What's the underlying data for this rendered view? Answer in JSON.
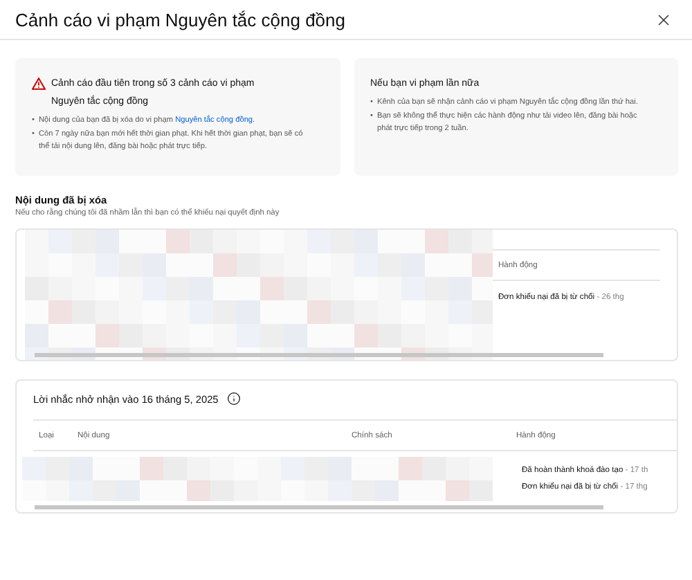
{
  "dialog": {
    "title": "Cảnh cáo vi phạm Nguyên tắc cộng đồng"
  },
  "warning_card": {
    "title": "Cảnh cáo đầu tiên trong số 3 cảnh cáo vi phạm Nguyên tắc cộng đồng",
    "bullets": [
      {
        "marker": "•",
        "text": "Nội dung của bạn đã bị xóa do vi phạm ",
        "link": "Nguyên tắc cộng đồng",
        "after": "."
      },
      {
        "marker": "•",
        "text": "Còn 7 ngày nữa bạn mới hết thời gian phạt. Khi hết thời gian phạt, bạn sẽ có thể tải nội dung lên, đăng bài hoặc phát trực tiếp."
      }
    ]
  },
  "next_card": {
    "title": "Nếu bạn vi phạm lần nữa",
    "bullets": [
      {
        "marker": "•",
        "text": "Kênh của bạn sẽ nhận cảnh cáo vi phạm Nguyên tắc cộng đồng lần thứ hai."
      },
      {
        "marker": "•",
        "text": "Bạn sẽ không thể thực hiện các hành động như tải video lên, đăng bài hoặc phát trực tiếp trong 2 tuần."
      }
    ]
  },
  "removed_content": {
    "heading": "Nội dung đã bị xóa",
    "subtitle": "Nếu cho rằng chúng tôi đã nhầm lẫn thì bạn có thể khiếu nại quyết định này",
    "columns": [
      "Hành động"
    ],
    "rows": [
      {
        "actions": [
          {
            "text": "Đơn khiếu nại đã bị từ chối",
            "date": "- 26 thg"
          }
        ]
      }
    ]
  },
  "reminder": {
    "title": "Lời nhắc nhở nhận vào 16 tháng 5, 2025",
    "columns": [
      "Loại",
      "Nội dung",
      "Chính sách",
      "Hành động"
    ],
    "rows": [
      {
        "actions": [
          {
            "text": "Đã hoàn thành khoá đào tạo",
            "date": "- 17 th"
          },
          {
            "text": "Đơn khiếu nại đã bị từ chối",
            "date": "- 17 thg"
          }
        ]
      }
    ]
  }
}
